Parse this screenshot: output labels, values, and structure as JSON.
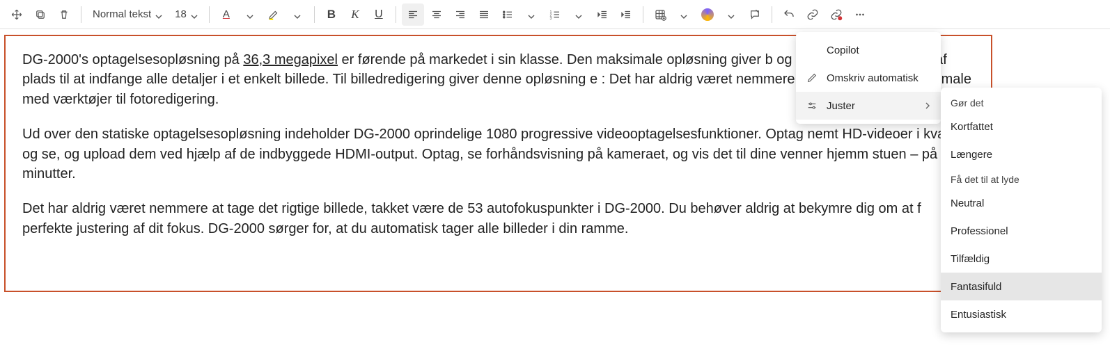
{
  "toolbar": {
    "style_name": "Normal tekst",
    "font_size": "18"
  },
  "document": {
    "p1_pre": "DG-2000's optagelsesopløsning på ",
    "p1_underlined": "36,3 megapixel",
    "p1_post": " er førende på markedet i sin klasse. Den maksimale opløsning giver b                              og professionelle masser af plads til at indfange alle detaljer i et enkelt billede. Til billedredigering giver denne opløsning e                               : Det har aldrig været nemmere at zoome, beskære og male med værktøjer til fotoredigering.",
    "p2": "Ud over den statiske optagelsesopløsning indeholder DG-2000 oprindelige 1080 progressive videooptagelsesfunktioner. Optag nemt HD-videoer i kvalitet, og se, og upload dem ved hjælp af de indbyggede HDMI-output. Optag, se forhåndsvisning på kameraet, og vis det til dine venner hjemm stuen – på få minutter.",
    "p3": "Det har aldrig været nemmere at tage det rigtige billede, takket være de 53 autofokuspunkter i DG-2000. Du behøver aldrig at bekymre dig om at f perfekte justering af dit fokus. DG-2000 sørger for, at du automatisk tager alle billeder i din ramme."
  },
  "copilot_menu": {
    "title": "Copilot",
    "rewrite": "Omskriv automatisk",
    "adjust": "Juster"
  },
  "adjust_menu": {
    "section1": "Gør det",
    "items1": [
      "Kortfattet",
      "Længere"
    ],
    "section2": "Få det til at lyde",
    "items2": [
      "Neutral",
      "Professionel",
      "Tilfældig",
      "Fantasifuld",
      "Entusiastisk"
    ]
  }
}
